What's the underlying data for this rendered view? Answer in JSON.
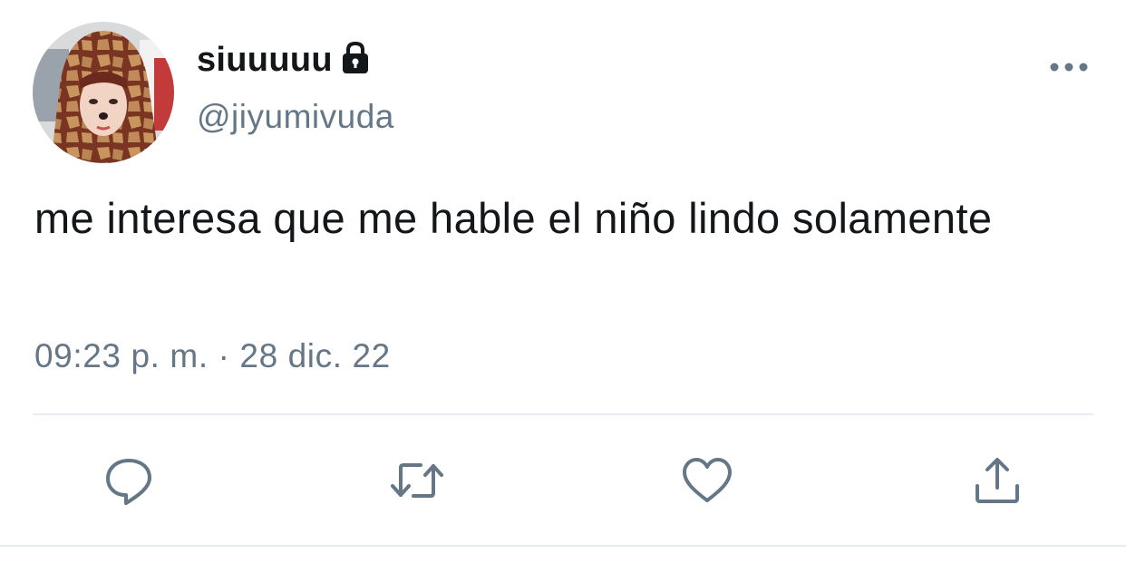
{
  "tweet": {
    "author": {
      "display_name": "siuuuuu",
      "handle": "@jiyumivuda",
      "protected_icon": "lock-icon"
    },
    "text": "me interesa que me hable el niño lindo solamente",
    "timestamp": "09:23 p. m. · 28 dic. 22"
  },
  "actions": [
    {
      "icon": "reply-icon"
    },
    {
      "icon": "retweet-icon"
    },
    {
      "icon": "like-icon"
    },
    {
      "icon": "share-icon"
    }
  ],
  "menu_icon": "more-options-icon",
  "colors": {
    "primary_text": "#14171a",
    "secondary_text": "#657786",
    "divider": "#e6ecf0",
    "icon": "#657786"
  }
}
